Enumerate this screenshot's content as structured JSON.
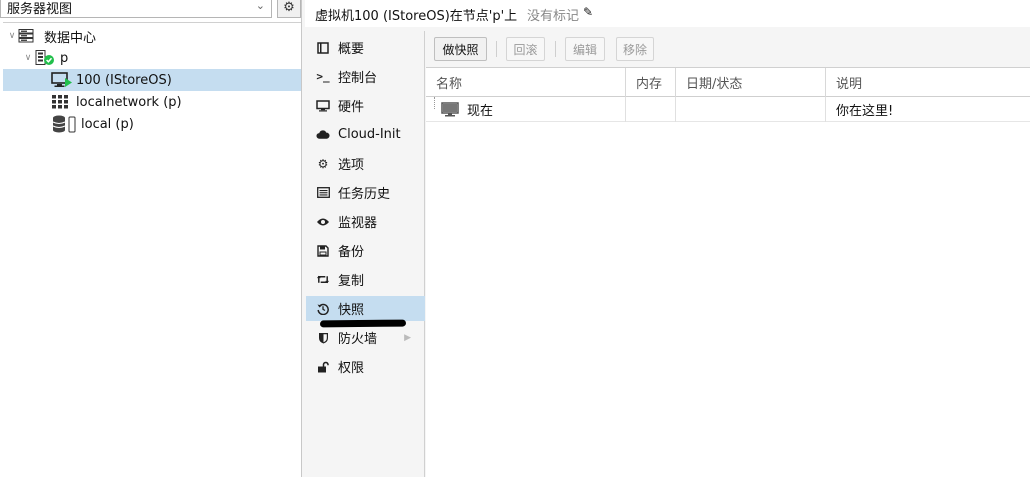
{
  "left_panel": {
    "view_selector": "服务器视图",
    "tree": {
      "datacenter": "数据中心",
      "node": "p",
      "vm": "100 (IStoreOS)",
      "network": "localnetwork (p)",
      "storage": "local (p)"
    }
  },
  "header": {
    "title": "虚拟机100 (IStoreOS)在节点'p'上",
    "tags": "没有标记"
  },
  "nav": {
    "items": [
      {
        "label": "概要",
        "icon": "book-icon"
      },
      {
        "label": "控制台",
        "icon": "terminal-icon"
      },
      {
        "label": "硬件",
        "icon": "monitor-icon"
      },
      {
        "label": "Cloud-Init",
        "icon": "cloud-icon"
      },
      {
        "label": "选项",
        "icon": "gear-icon"
      },
      {
        "label": "任务历史",
        "icon": "list-icon"
      },
      {
        "label": "监视器",
        "icon": "eye-icon"
      },
      {
        "label": "备份",
        "icon": "floppy-icon"
      },
      {
        "label": "复制",
        "icon": "retweet-icon"
      },
      {
        "label": "快照",
        "icon": "history-icon"
      },
      {
        "label": "防火墙",
        "icon": "shield-icon"
      },
      {
        "label": "权限",
        "icon": "unlock-icon"
      }
    ],
    "selected": "快照"
  },
  "toolbar": {
    "take_snapshot": "做快照",
    "rollback": "回滚",
    "edit": "编辑",
    "remove": "移除"
  },
  "grid": {
    "columns": [
      "名称",
      "内存",
      "日期/状态",
      "说明"
    ],
    "rows": [
      {
        "name": "现在",
        "ram": "",
        "date": "",
        "description": "你在这里!"
      }
    ]
  },
  "colors": {
    "selection": "#c5ddf0",
    "running_green": "#21bf4b"
  }
}
